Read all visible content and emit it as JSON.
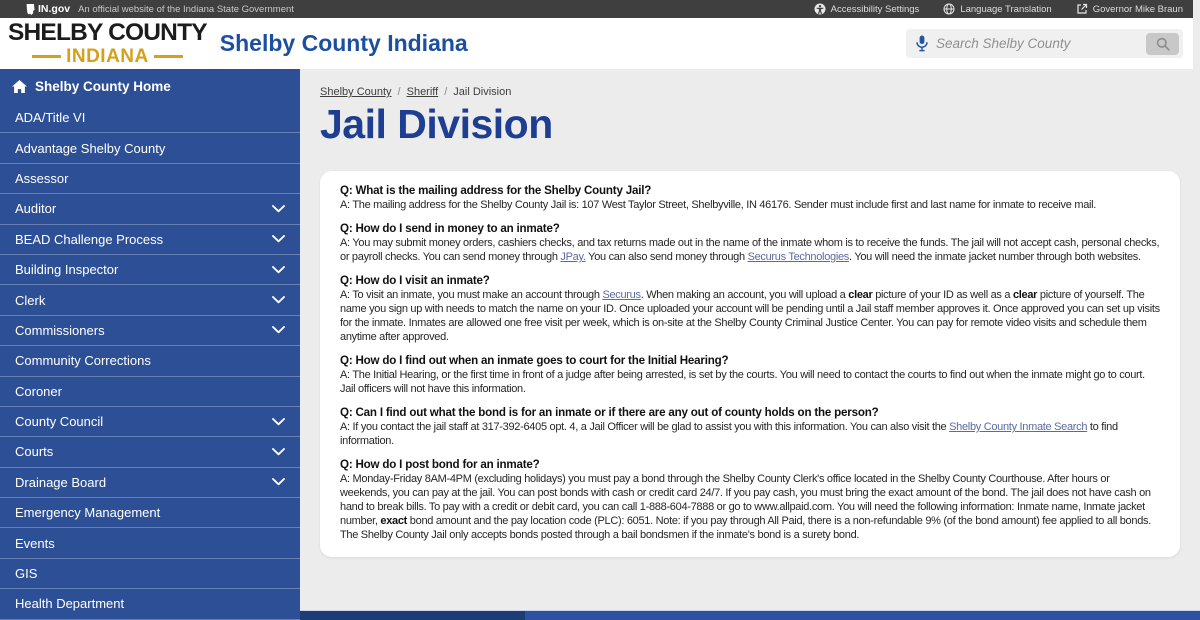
{
  "colors": {
    "topbar_gray": "#3f3f3f",
    "sidebar_blue": "#2d4f96",
    "title_blue": "#1e3e92",
    "site_title_blue": "#1d4fa0",
    "brand_gold": "#d4a11e",
    "content_link_blue": "#5a6aa5",
    "footer_navy": "#1e3c76",
    "footer_blue": "#2e52a2"
  },
  "topbar": {
    "logo": "IN.gov",
    "official_text": "An official website of the Indiana State Government",
    "links": [
      {
        "label": "Accessibility Settings",
        "icon": "accessibility-icon"
      },
      {
        "label": "Language Translation",
        "icon": "globe-icon"
      },
      {
        "label": "Governor Mike Braun",
        "icon": "external-link-icon"
      }
    ]
  },
  "header": {
    "logo_line1": "SHELBY COUNTY",
    "logo_line2": "INDIANA",
    "site_title": "Shelby County Indiana",
    "search_placeholder": "Search Shelby County",
    "search_value": ""
  },
  "sidebar": {
    "home_label": "Shelby County Home",
    "items": [
      {
        "label": "ADA/Title VI",
        "expandable": false
      },
      {
        "label": "Advantage Shelby County",
        "expandable": false
      },
      {
        "label": "Assessor",
        "expandable": false
      },
      {
        "label": "Auditor",
        "expandable": true
      },
      {
        "label": "BEAD Challenge Process",
        "expandable": true
      },
      {
        "label": "Building Inspector",
        "expandable": true
      },
      {
        "label": "Clerk",
        "expandable": true
      },
      {
        "label": "Commissioners",
        "expandable": true
      },
      {
        "label": "Community Corrections",
        "expandable": false
      },
      {
        "label": "Coroner",
        "expandable": false
      },
      {
        "label": "County Council",
        "expandable": true
      },
      {
        "label": "Courts",
        "expandable": true
      },
      {
        "label": "Drainage Board",
        "expandable": true
      },
      {
        "label": "Emergency Management",
        "expandable": false
      },
      {
        "label": "Events",
        "expandable": false
      },
      {
        "label": "GIS",
        "expandable": false
      },
      {
        "label": "Health Department",
        "expandable": false
      }
    ]
  },
  "breadcrumb": {
    "separator": "/",
    "items": [
      "Shelby County",
      "Sheriff",
      "Jail Division"
    ]
  },
  "page": {
    "title": "Jail Division"
  },
  "faq": [
    {
      "question": "Q: What is the mailing address for the Shelby County Jail?",
      "answer": [
        {
          "t": "A: The mailing address for the Shelby County Jail is: 107 West Taylor Street, Shelbyville, IN 46176. Sender must include first and last name for inmate to receive mail.",
          "s": "plain"
        }
      ]
    },
    {
      "question": "Q: How do I send in money to an inmate?",
      "answer": [
        {
          "t": "A: You may submit money orders, cashiers checks, and tax returns made out in the name of the inmate whom is to receive the funds. The jail will not accept cash, personal checks, or payroll checks. You can send money through ",
          "s": "plain"
        },
        {
          "t": "JPay.",
          "s": "link"
        },
        {
          "t": " You can also send money through ",
          "s": "plain"
        },
        {
          "t": "Securus Technologies",
          "s": "link"
        },
        {
          "t": ". You will need the inmate jacket number through both websites.",
          "s": "plain"
        }
      ]
    },
    {
      "question": "Q: How do I visit an inmate?",
      "answer": [
        {
          "t": "A: To visit an inmate, you must make an account through ",
          "s": "plain"
        },
        {
          "t": "Securus",
          "s": "link"
        },
        {
          "t": ". When making an account, you will upload a ",
          "s": "plain"
        },
        {
          "t": "clear",
          "s": "bold"
        },
        {
          "t": " picture of your ID as well as a ",
          "s": "plain"
        },
        {
          "t": "clear",
          "s": "bold"
        },
        {
          "t": " picture of yourself. The name you sign up with needs to match the name on your ID. Once uploaded your account will be pending until a Jail staff member approves it. Once approved you can set up visits for the inmate. Inmates are allowed one free visit per week, which is on-site at the Shelby County Criminal Justice Center. You can pay for remote video visits and schedule them anytime after approved.",
          "s": "plain"
        }
      ]
    },
    {
      "question": "Q: How do I find out when an inmate goes to court for the Initial Hearing?",
      "answer": [
        {
          "t": "A: The Initial Hearing, or the first time in front of a judge after being arrested, is set by the courts. You will need to contact the courts to find out when the inmate might go to court. Jail officers will not have this information.",
          "s": "plain"
        }
      ]
    },
    {
      "question": "Q: Can I find out what the bond is for an inmate or if there are any out of county holds on the person?",
      "answer": [
        {
          "t": "A: If you contact the jail staff at 317-392-6405 opt. 4, a Jail Officer will be glad to assist you with this information. You can also visit the ",
          "s": "plain"
        },
        {
          "t": "Shelby County Inmate Search",
          "s": "link"
        },
        {
          "t": " to find information.",
          "s": "plain"
        }
      ]
    },
    {
      "question": "Q: How do I post bond for an inmate?",
      "answer": [
        {
          "t": "A: Monday-Friday 8AM-4PM (excluding holidays) you must pay a bond through the Shelby County Clerk's office located in the Shelby County Courthouse. After hours or weekends, you can pay at the jail. You can post bonds with cash or credit card 24/7. If you pay cash, you must bring the exact amount of the bond. The jail does not have cash on hand to break bills. To pay with a credit or debit card, you can call 1-888-604-7888 or go to www.allpaid.com. You will need the following information: Inmate name, Inmate jacket number, ",
          "s": "plain"
        },
        {
          "t": "exact",
          "s": "bold"
        },
        {
          "t": " bond amount and the pay location code (PLC): 6051. Note: if you pay through All Paid, there is a non-refundable 9% (of the bond amount) fee applied to all bonds. The Shelby County Jail only accepts bonds posted through a bail bondsmen if the inmate's bond is a surety bond.",
          "s": "plain"
        }
      ]
    }
  ]
}
